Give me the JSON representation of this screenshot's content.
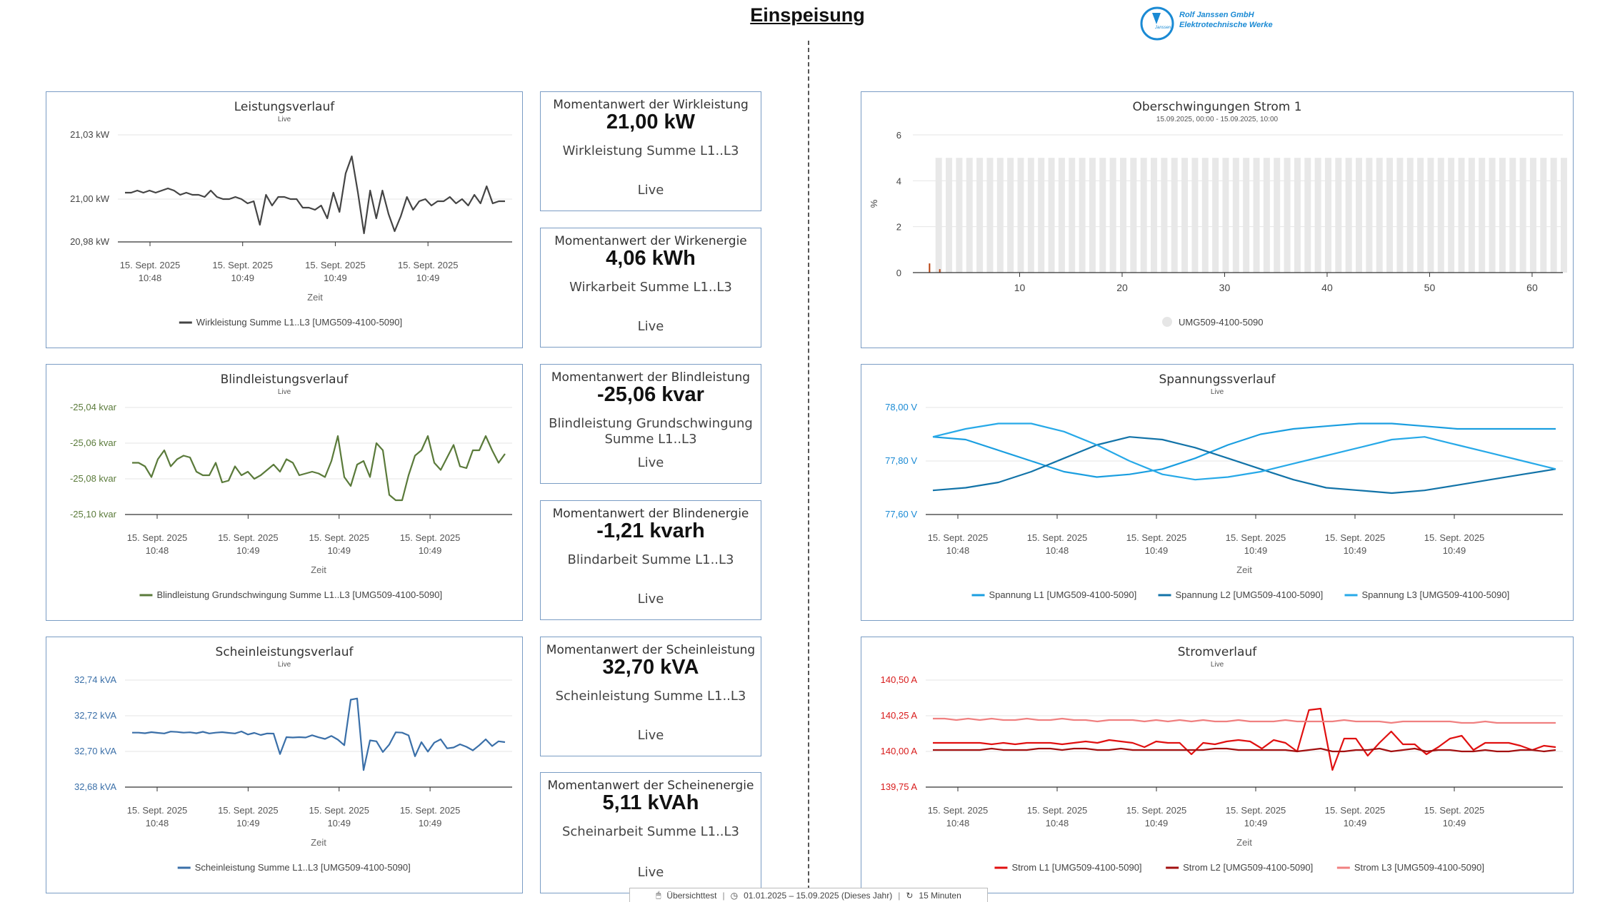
{
  "page": {
    "title": "Einspeisung",
    "logo": {
      "line1": "Rolf Janssen GmbH",
      "line2": "Elektrotechnische Werke",
      "mark": "Janssen"
    }
  },
  "footer": {
    "view_name": "Übersichttest",
    "date_range": "01.01.2025 – 15.09.2025 (Dieses Jahr)",
    "refresh": "15 Minuten"
  },
  "cards": [
    {
      "title": "Momentanwert der Wirkleistung",
      "value": "21,00 kW",
      "desc": "Wirkleistung Summe L1..L3",
      "live": "Live"
    },
    {
      "title": "Momentanwert der Wirkenergie",
      "value": "4,06 kWh",
      "desc": "Wirkarbeit Summe L1..L3",
      "live": "Live"
    },
    {
      "title": "Momentanwert der Blindleistung",
      "value": "-25,06 kvar",
      "desc": "Blindleistung Grundschwingung Summe L1..L3",
      "live": "Live"
    },
    {
      "title": "Momentanwert der Blindenergie",
      "value": "-1,21 kvarh",
      "desc": "Blindarbeit Summe L1..L3",
      "live": "Live"
    },
    {
      "title": "Momentanwert der Scheinleistung",
      "value": "32,70 kVA",
      "desc": "Scheinleistung Summe L1..L3",
      "live": "Live"
    },
    {
      "title": "Momentanwert der Scheinenergie",
      "value": "5,11 kVAh",
      "desc": "Scheinarbeit Summe L1..L3",
      "live": "Live"
    }
  ],
  "chart_data": [
    {
      "id": "wirk",
      "type": "line",
      "title": "Leistungsverlauf",
      "subtitle": "Live",
      "xlabel": "Zeit",
      "x_ticks": [
        "15. Sept. 2025|10:48",
        "15. Sept. 2025|10:49",
        "15. Sept. 2025|10:49",
        "15. Sept. 2025|10:49"
      ],
      "y_ticks": [
        "21,03 kW",
        "21,00 kW",
        "20,98 kW"
      ],
      "y_tick_values": [
        21.03,
        21.0,
        20.98
      ],
      "ylim": [
        20.98,
        21.03
      ],
      "y_color": "#444444",
      "series": [
        {
          "name": "Wirkleistung Summe L1..L3 [UMG509-4100-5090]",
          "color": "#444444",
          "values": [
            21.003,
            21.003,
            21.004,
            21.003,
            21.004,
            21.003,
            21.004,
            21.005,
            21.004,
            21.002,
            21.003,
            21.002,
            21.002,
            21.001,
            21.004,
            21.001,
            21.0,
            21.0,
            21.001,
            21.0,
            20.998,
            20.999,
            20.988,
            21.002,
            20.997,
            21.001,
            21.001,
            21.0,
            21.0,
            20.996,
            20.996,
            20.995,
            20.997,
            20.991,
            21.003,
            20.994,
            21.012,
            21.02,
            21.003,
            20.984,
            21.004,
            20.991,
            21.004,
            20.993,
            20.985,
            20.992,
            21.001,
            20.995,
            20.999,
            21.0,
            20.997,
            20.999,
            20.999,
            21.001,
            20.998,
            21.0,
            20.997,
            21.002,
            20.998,
            21.006,
            20.998,
            20.999,
            20.999
          ]
        }
      ]
    },
    {
      "id": "blind",
      "type": "line",
      "title": "Blindleistungsverlauf",
      "subtitle": "Live",
      "xlabel": "Zeit",
      "x_ticks": [
        "15. Sept. 2025|10:48",
        "15. Sept. 2025|10:49",
        "15. Sept. 2025|10:49",
        "15. Sept. 2025|10:49"
      ],
      "y_ticks": [
        "-25,04 kvar",
        "-25,06 kvar",
        "-25,08 kvar",
        "-25,10 kvar"
      ],
      "y_tick_values": [
        -25.04,
        -25.06,
        -25.08,
        -25.1
      ],
      "ylim": [
        -25.1,
        -25.04
      ],
      "y_color": "#5a7a3a",
      "series": [
        {
          "name": "Blindleistung Grundschwingung Summe L1..L3 [UMG509-4100-5090]",
          "color": "#5a7a3a",
          "values": [
            -25.071,
            -25.071,
            -25.073,
            -25.079,
            -25.069,
            -25.064,
            -25.073,
            -25.069,
            -25.067,
            -25.068,
            -25.076,
            -25.078,
            -25.078,
            -25.071,
            -25.082,
            -25.081,
            -25.073,
            -25.078,
            -25.076,
            -25.08,
            -25.078,
            -25.075,
            -25.072,
            -25.076,
            -25.069,
            -25.071,
            -25.078,
            -25.077,
            -25.076,
            -25.077,
            -25.079,
            -25.07,
            -25.056,
            -25.079,
            -25.084,
            -25.072,
            -25.07,
            -25.079,
            -25.06,
            -25.064,
            -25.089,
            -25.092,
            -25.092,
            -25.078,
            -25.067,
            -25.064,
            -25.056,
            -25.071,
            -25.075,
            -25.068,
            -25.061,
            -25.073,
            -25.074,
            -25.064,
            -25.064,
            -25.056,
            -25.064,
            -25.071,
            -25.066
          ]
        }
      ]
    },
    {
      "id": "schein",
      "type": "line",
      "title": "Scheinleistungsverlauf",
      "subtitle": "Live",
      "xlabel": "Zeit",
      "x_ticks": [
        "15. Sept. 2025|10:48",
        "15. Sept. 2025|10:49",
        "15. Sept. 2025|10:49",
        "15. Sept. 2025|10:49"
      ],
      "y_ticks": [
        "32,74 kVA",
        "32,72 kVA",
        "32,70 kVA",
        "32,68 kVA"
      ],
      "y_tick_values": [
        32.74,
        32.72,
        32.7,
        32.68
      ],
      "ylim": [
        32.68,
        32.74
      ],
      "y_color": "#3a6fa8",
      "series": [
        {
          "name": "Scheinleistung Summe L1..L3 [UMG509-4100-5090]",
          "color": "#3a6fa8",
          "values": [
            32.7105,
            32.7105,
            32.7102,
            32.7108,
            32.7104,
            32.7101,
            32.7111,
            32.7109,
            32.7105,
            32.7107,
            32.7102,
            32.711,
            32.7101,
            32.7105,
            32.7108,
            32.7104,
            32.7101,
            32.7112,
            32.7095,
            32.7104,
            32.7092,
            32.7101,
            32.71,
            32.6985,
            32.708,
            32.7078,
            32.708,
            32.7078,
            32.7091,
            32.7079,
            32.707,
            32.7087,
            32.7066,
            32.7035,
            32.729,
            32.7297,
            32.6895,
            32.7062,
            32.7057,
            32.6997,
            32.7039,
            32.7107,
            32.7105,
            32.709,
            32.6973,
            32.7052,
            32.6999,
            32.7049,
            32.7068,
            32.7017,
            32.7022,
            32.704,
            32.7026,
            32.7006,
            32.7035,
            32.7068,
            32.703,
            32.7057,
            32.7052
          ]
        }
      ]
    },
    {
      "id": "harm",
      "type": "bar",
      "title": "Oberschwingungen Strom 1",
      "subtitle": "15.09.2025, 00:00 - 15.09.2025, 10:00",
      "ylabel": "%",
      "ylim": [
        0,
        6
      ],
      "y_ticks": [
        "6",
        "4",
        "2",
        "0"
      ],
      "y_tick_values": [
        6,
        4,
        2,
        0
      ],
      "x_ticks": [
        "10",
        "20",
        "30",
        "40",
        "50",
        "60"
      ],
      "x_tick_values": [
        10,
        20,
        30,
        40,
        50,
        60
      ],
      "xlim": [
        0,
        63
      ],
      "band_max": 5,
      "series": [
        {
          "name": "UMG509-4100-5090",
          "color": "#e8e8e8",
          "values": [
            0.4,
            0.15,
            0,
            0,
            0,
            0,
            0,
            0,
            0,
            0
          ]
        }
      ]
    },
    {
      "id": "spann",
      "type": "line",
      "title": "Spannungssverlauf",
      "subtitle": "Live",
      "xlabel": "Zeit",
      "x_ticks": [
        "15. Sept. 2025|10:48",
        "15. Sept. 2025|10:48",
        "15. Sept. 2025|10:49",
        "15. Sept. 2025|10:49",
        "15. Sept. 2025|10:49",
        "15. Sept. 2025|10:49"
      ],
      "y_ticks": [
        "78,00 V",
        "77,80 V",
        "77,60 V"
      ],
      "y_tick_values": [
        78.0,
        77.8,
        77.6
      ],
      "ylim": [
        77.6,
        78.0
      ],
      "y_color": "#1a8ad4",
      "series": [
        {
          "name": "Spannung L1 [UMG509-4100-5090]",
          "color": "#1a9ee0",
          "values": [
            77.89,
            77.88,
            77.84,
            77.8,
            77.76,
            77.74,
            77.75,
            77.77,
            77.81,
            77.86,
            77.9,
            77.92,
            77.93,
            77.94,
            77.94,
            77.93,
            77.92,
            77.92,
            77.92,
            77.92
          ]
        },
        {
          "name": "Spannung L2 [UMG509-4100-5090]",
          "color": "#1273a8",
          "values": [
            77.69,
            77.7,
            77.72,
            77.76,
            77.81,
            77.86,
            77.89,
            77.88,
            77.85,
            77.81,
            77.77,
            77.73,
            77.7,
            77.69,
            77.68,
            77.69,
            77.71,
            77.73,
            77.75,
            77.77
          ]
        },
        {
          "name": "Spannung L3 [UMG509-4100-5090]",
          "color": "#27a9e8",
          "values": [
            77.89,
            77.92,
            77.94,
            77.94,
            77.91,
            77.86,
            77.8,
            77.75,
            77.73,
            77.74,
            77.76,
            77.79,
            77.82,
            77.85,
            77.88,
            77.89,
            77.86,
            77.83,
            77.8,
            77.77
          ]
        }
      ]
    },
    {
      "id": "strom",
      "type": "line",
      "title": "Stromverlauf",
      "subtitle": "Live",
      "xlabel": "Zeit",
      "x_ticks": [
        "15. Sept. 2025|10:48",
        "15. Sept. 2025|10:48",
        "15. Sept. 2025|10:49",
        "15. Sept. 2025|10:49",
        "15. Sept. 2025|10:49",
        "15. Sept. 2025|10:49"
      ],
      "y_ticks": [
        "140,50 A",
        "140,25 A",
        "140,00 A",
        "139,75 A"
      ],
      "y_tick_values": [
        140.5,
        140.25,
        140.0,
        139.75
      ],
      "ylim": [
        139.75,
        140.5
      ],
      "y_color": "#d81b1b",
      "series": [
        {
          "name": "Strom L1 [UMG509-4100-5090]",
          "color": "#e01010",
          "values": [
            140.06,
            140.06,
            140.06,
            140.06,
            140.06,
            140.05,
            140.06,
            140.05,
            140.06,
            140.06,
            140.06,
            140.05,
            140.06,
            140.07,
            140.06,
            140.08,
            140.07,
            140.06,
            140.03,
            140.07,
            140.06,
            140.06,
            139.98,
            140.06,
            140.05,
            140.07,
            140.08,
            140.07,
            140.02,
            140.08,
            140.06,
            140.0,
            140.29,
            140.3,
            139.87,
            140.09,
            140.09,
            139.97,
            140.06,
            140.14,
            140.05,
            140.05,
            139.98,
            140.03,
            140.09,
            140.11,
            140.01,
            140.06,
            140.06,
            140.06,
            140.04,
            140.01,
            140.04,
            140.03
          ]
        },
        {
          "name": "Strom L2 [UMG509-4100-5090]",
          "color": "#a31010",
          "values": [
            140.01,
            140.01,
            140.01,
            140.01,
            140.01,
            140.02,
            140.01,
            140.01,
            140.01,
            140.02,
            140.02,
            140.01,
            140.02,
            140.02,
            140.01,
            140.01,
            140.02,
            140.01,
            140.01,
            140.01,
            140.01,
            140.01,
            140.01,
            140.01,
            140.02,
            140.02,
            140.01,
            140.01,
            140.01,
            140.01,
            140.01,
            140.0,
            140.01,
            140.02,
            140.0,
            140.0,
            140.01,
            140.01,
            140.02,
            140.0,
            140.01,
            140.02,
            140.0,
            140.01,
            140.01,
            140.0,
            140.0,
            140.01,
            140.0,
            140.0,
            140.01,
            140.01,
            140.0,
            140.01
          ]
        },
        {
          "name": "Strom L3 [UMG509-4100-5090]",
          "color": "#f08080",
          "values": [
            140.23,
            140.23,
            140.22,
            140.23,
            140.22,
            140.23,
            140.22,
            140.22,
            140.23,
            140.22,
            140.22,
            140.23,
            140.22,
            140.22,
            140.21,
            140.22,
            140.22,
            140.22,
            140.21,
            140.22,
            140.21,
            140.22,
            140.21,
            140.22,
            140.21,
            140.21,
            140.22,
            140.21,
            140.21,
            140.21,
            140.22,
            140.21,
            140.21,
            140.21,
            140.21,
            140.22,
            140.21,
            140.21,
            140.21,
            140.2,
            140.21,
            140.21,
            140.21,
            140.21,
            140.21,
            140.2,
            140.2,
            140.21,
            140.2,
            140.2,
            140.2,
            140.2,
            140.2,
            140.2
          ]
        }
      ]
    }
  ]
}
